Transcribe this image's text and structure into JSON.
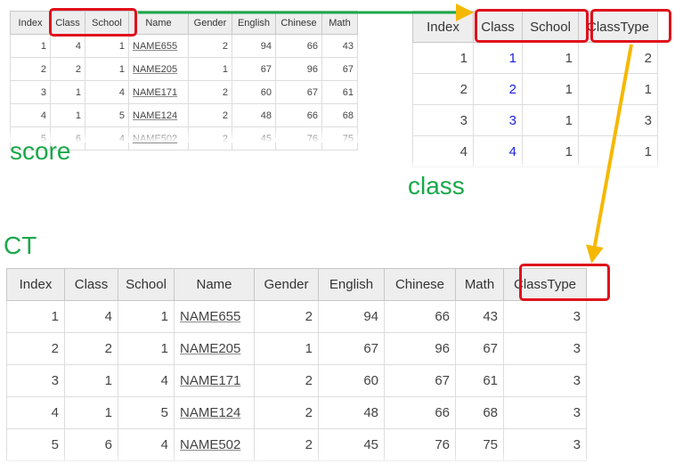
{
  "captions": {
    "score": "score",
    "class": "class",
    "ct": "CT"
  },
  "score": {
    "headers": [
      "Index",
      "Class",
      "School",
      "Name",
      "Gender",
      "English",
      "Chinese",
      "Math"
    ],
    "rows": [
      [
        "1",
        "4",
        "1",
        "NAME655",
        "2",
        "94",
        "66",
        "43"
      ],
      [
        "2",
        "2",
        "1",
        "NAME205",
        "1",
        "67",
        "96",
        "67"
      ],
      [
        "3",
        "1",
        "4",
        "NAME171",
        "2",
        "60",
        "67",
        "61"
      ],
      [
        "4",
        "1",
        "5",
        "NAME124",
        "2",
        "48",
        "66",
        "68"
      ],
      [
        "5",
        "6",
        "4",
        "NAME502",
        "2",
        "45",
        "76",
        "75"
      ]
    ]
  },
  "class": {
    "headers": [
      "Index",
      "Class",
      "School",
      "ClassType"
    ],
    "rows": [
      [
        "1",
        "1",
        "1",
        "2"
      ],
      [
        "2",
        "2",
        "1",
        "1"
      ],
      [
        "3",
        "3",
        "1",
        "3"
      ],
      [
        "4",
        "4",
        "1",
        "1"
      ]
    ]
  },
  "ct": {
    "headers": [
      "Index",
      "Class",
      "School",
      "Name",
      "Gender",
      "English",
      "Chinese",
      "Math",
      "ClassType"
    ],
    "rows": [
      [
        "1",
        "4",
        "1",
        "NAME655",
        "2",
        "94",
        "66",
        "43",
        "3"
      ],
      [
        "2",
        "2",
        "1",
        "NAME205",
        "1",
        "67",
        "96",
        "67",
        "3"
      ],
      [
        "3",
        "1",
        "4",
        "NAME171",
        "2",
        "60",
        "67",
        "61",
        "3"
      ],
      [
        "4",
        "1",
        "5",
        "NAME124",
        "2",
        "48",
        "66",
        "68",
        "3"
      ],
      [
        "5",
        "6",
        "4",
        "NAME502",
        "2",
        "45",
        "76",
        "75",
        "3"
      ]
    ]
  },
  "colors": {
    "highlight": "#e0101a",
    "green_arrow": "#1aa84a",
    "yellow_arrow": "#f5b800",
    "caption": "#1aa84a",
    "class_value": "#1a22dd"
  }
}
